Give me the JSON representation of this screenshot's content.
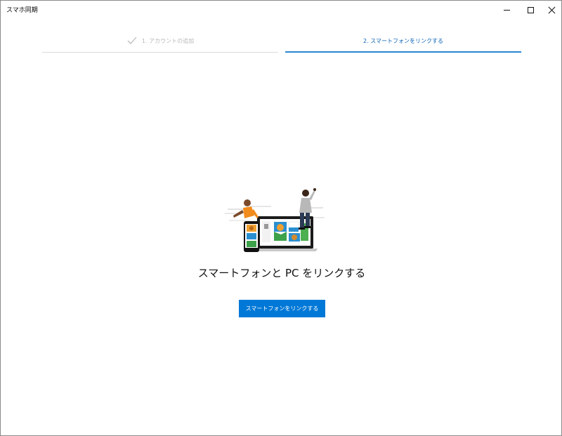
{
  "window": {
    "title": "スマホ同期",
    "controls": {
      "minimize": "minimize-icon",
      "maximize": "maximize-icon",
      "close": "close-icon"
    }
  },
  "stepper": {
    "steps": [
      {
        "label": "1. アカウントの追加",
        "state": "completed",
        "icon": "check-icon"
      },
      {
        "label": "2. スマートフォンをリンクする",
        "state": "current"
      }
    ]
  },
  "main": {
    "illustration": "people-devices-illustration",
    "title": "スマートフォンと PC をリンクする",
    "button_label": "スマートフォンをリンクする"
  },
  "colors": {
    "accent": "#0078d7",
    "active_step": "#0a63b8",
    "inactive_step": "#b8b8b8"
  }
}
